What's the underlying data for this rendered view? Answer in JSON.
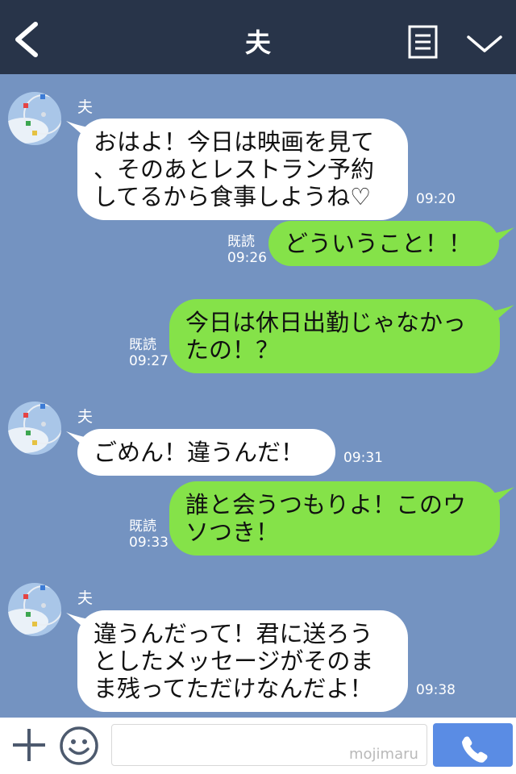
{
  "header": {
    "title": "夫"
  },
  "messages": [
    {
      "sender": "夫",
      "text": "おはよ！今日は映画を見て\n、そのあとレストラン予約\nしてるから食事しようね♡",
      "time": "09:20"
    },
    {
      "text": "どういうこと！！",
      "time": "09:26",
      "read": "既読"
    },
    {
      "text": "今日は休日出勤じゃなかっ\nたの！？",
      "time": "09:27",
      "read": "既読"
    },
    {
      "sender": "夫",
      "text": "ごめん！違うんだ！",
      "time": "09:31"
    },
    {
      "text": "誰と会うつもりよ！このウ\nソつき！",
      "time": "09:33",
      "read": "既読"
    },
    {
      "sender": "夫",
      "text": "違うんだって！君に送ろう\nとしたメッセージがそのま\nま残ってただけなんだよ！",
      "time": "09:38"
    }
  ],
  "input": {
    "watermark": "mojimaru"
  },
  "icons": {
    "back": "chevron-left-icon",
    "menu": "document-list-icon",
    "collapse": "chevron-down-icon",
    "plus": "plus-icon",
    "sticker": "smiley-icon",
    "call": "phone-icon"
  },
  "colors": {
    "header": "#283449",
    "chat_background": "#7493c1",
    "incoming_bubble": "#ffffff",
    "outgoing_bubble": "#85e249",
    "call_button": "#5a8ce4"
  }
}
